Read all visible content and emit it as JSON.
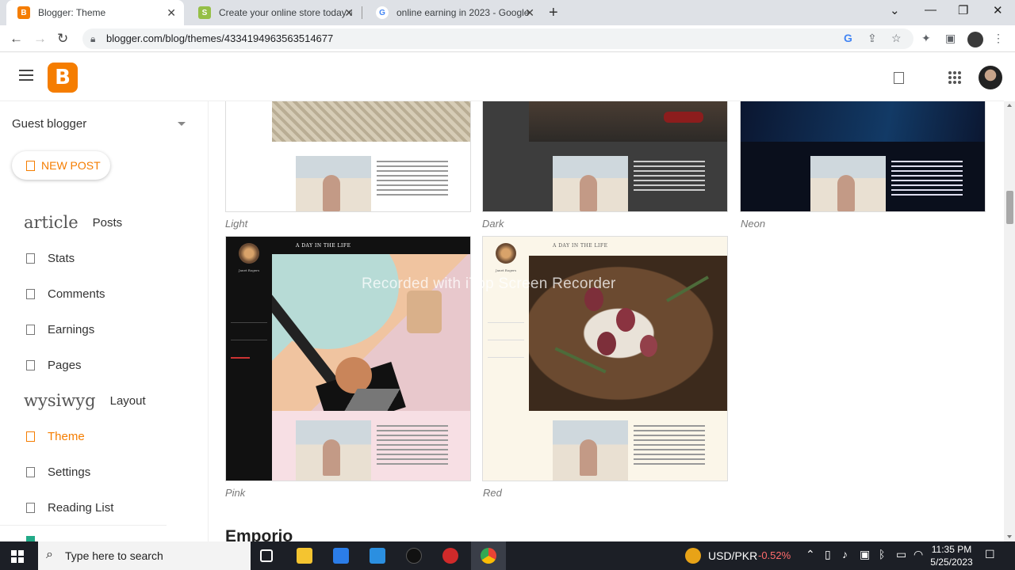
{
  "browser": {
    "tabs": [
      {
        "title": "Blogger: Theme",
        "active": true,
        "favicon_color": "#f57d00"
      },
      {
        "title": "Create your online store today w",
        "active": false,
        "favicon_color": "#95bf47"
      },
      {
        "title": "online earning in 2023 - Google",
        "active": false,
        "favicon_color": "#4285f4"
      }
    ],
    "url": "blogger.com/blog/themes/4334194963563514677"
  },
  "sidebar": {
    "blog_name": "Guest blogger",
    "new_post_label": "NEW POST",
    "items": [
      {
        "icon_word": "article",
        "label": "Posts"
      },
      {
        "label": "Stats"
      },
      {
        "label": "Comments"
      },
      {
        "label": "Earnings"
      },
      {
        "label": "Pages"
      },
      {
        "icon_word": "wysiwyg",
        "label": "Layout"
      },
      {
        "label": "Theme",
        "active": true
      },
      {
        "label": "Settings"
      },
      {
        "label": "Reading List"
      }
    ]
  },
  "themes": {
    "row1": [
      "Light",
      "Dark",
      "Neon"
    ],
    "row2": [
      "Pink",
      "Red"
    ],
    "preview_heading": "A DAY IN THE LIFE",
    "preview_author": "Janet Rogers",
    "next_section": "Emporio"
  },
  "watermark": "Recorded with iTop Screen Recorder",
  "taskbar": {
    "search_placeholder": "Type here to search",
    "fx_pair": "USD/PKR",
    "fx_change": "-0.52%",
    "time": "11:35 PM",
    "date": "5/25/2023"
  },
  "colors": {
    "accent": "#f57d00",
    "taskbar": "#1c1f26"
  }
}
